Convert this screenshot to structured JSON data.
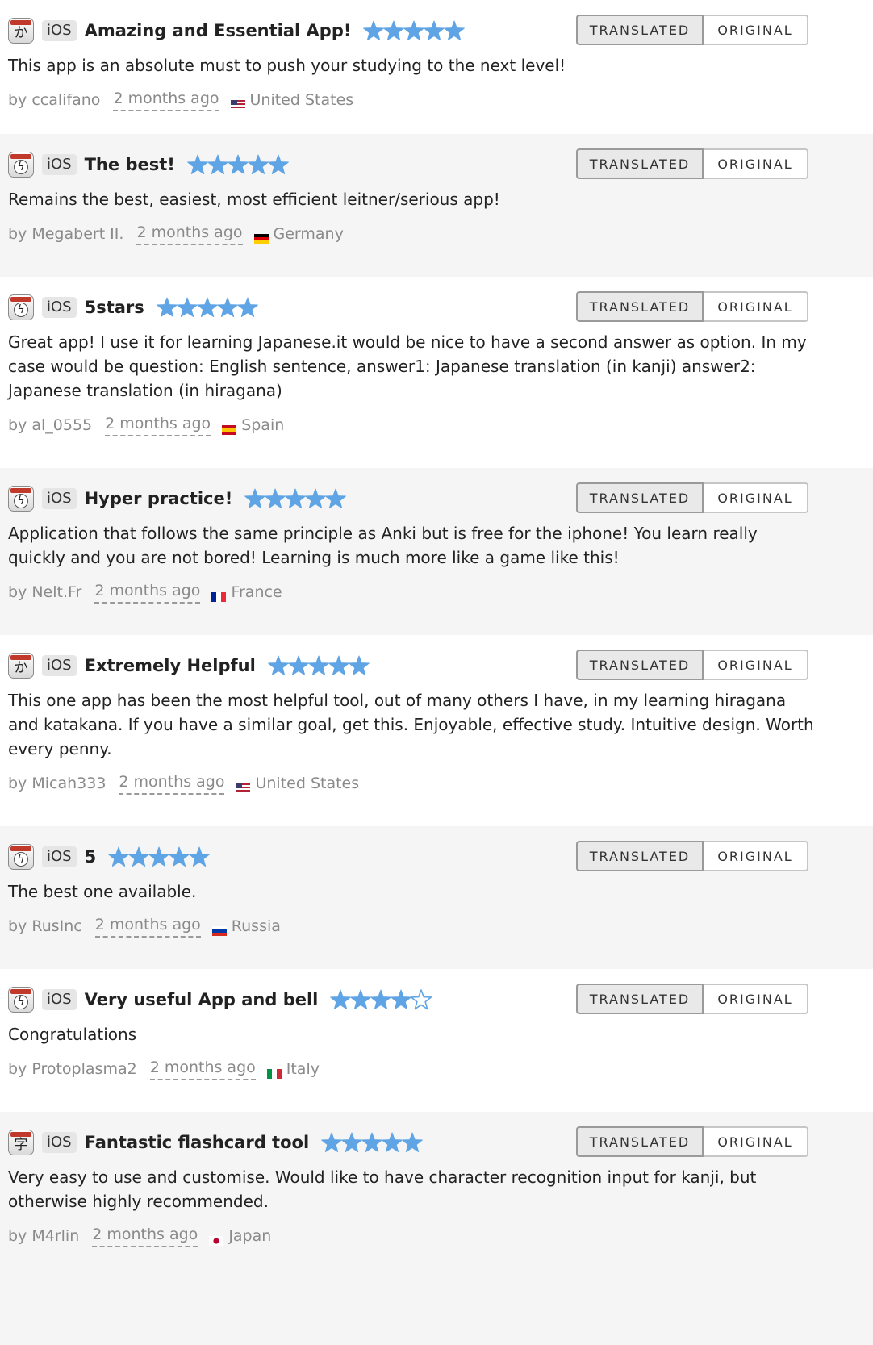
{
  "buttons": {
    "translated": "TRANSLATED",
    "original": "ORIGINAL"
  },
  "reviews": [
    {
      "icon": "kana-app-icon",
      "icon_glyph": "か",
      "platform": "iOS",
      "title": "Amazing and Essential App!",
      "rating": 5,
      "max_rating": 5,
      "body": "This app is an absolute must to push your studying to the next level!",
      "author": "by ccalifano",
      "time": "2 months ago",
      "country": "United States",
      "flag": "us-flag-icon"
    },
    {
      "icon": "flashcard-app-icon",
      "icon_glyph": "ϟ",
      "platform": "iOS",
      "title": "The best!",
      "rating": 5,
      "max_rating": 5,
      "body": "Remains the best, easiest, most efficient leitner/serious app!",
      "author": "by Megabert II.",
      "time": "2 months ago",
      "country": "Germany",
      "flag": "de-flag-icon"
    },
    {
      "icon": "flashcard-app-icon",
      "icon_glyph": "ϟ",
      "platform": "iOS",
      "title": "5stars",
      "rating": 5,
      "max_rating": 5,
      "body": "Great app! I use it for learning Japanese.it would be nice to have a second answer as option. In my case would be question: English sentence, answer1: Japanese translation (in kanji) answer2: Japanese translation (in hiragana)",
      "author": "by al_0555",
      "time": "2 months ago",
      "country": "Spain",
      "flag": "es-flag-icon"
    },
    {
      "icon": "flashcard-lite-app-icon",
      "icon_glyph": "ϟ",
      "platform": "iOS",
      "title": "Hyper practice!",
      "rating": 5,
      "max_rating": 5,
      "body": "Application that follows the same principle as Anki but is free for the iphone! You learn really quickly and you are not bored! Learning is much more like a game like this!",
      "author": "by Nelt.Fr",
      "time": "2 months ago",
      "country": "France",
      "flag": "fr-flag-icon"
    },
    {
      "icon": "kana-app-icon",
      "icon_glyph": "か",
      "platform": "iOS",
      "title": "Extremely Helpful",
      "rating": 5,
      "max_rating": 5,
      "body": "This one app has been the most helpful tool, out of many others I have, in my learning hiragana and katakana. If you have a similar goal, get this. Enjoyable, effective study. Intuitive design. Worth every penny.",
      "author": "by Micah333",
      "time": "2 months ago",
      "country": "United States",
      "flag": "us-flag-icon"
    },
    {
      "icon": "flashcard-app-icon",
      "icon_glyph": "ϟ",
      "platform": "iOS",
      "title": "5",
      "rating": 5,
      "max_rating": 5,
      "body": "The best one available.",
      "author": "by RusInc",
      "time": "2 months ago",
      "country": "Russia",
      "flag": "ru-flag-icon"
    },
    {
      "icon": "flashcard-lite-app-icon",
      "icon_glyph": "ϟ",
      "platform": "iOS",
      "title": "Very useful App and bell",
      "rating": 4,
      "max_rating": 5,
      "body": "Congratulations",
      "author": "by Protoplasma2",
      "time": "2 months ago",
      "country": "Italy",
      "flag": "it-flag-icon"
    },
    {
      "icon": "kanji-app-icon",
      "icon_glyph": "字",
      "platform": "iOS",
      "title": "Fantastic flashcard tool",
      "rating": 5,
      "max_rating": 5,
      "body": "Very easy to use and customise. Would like to have character recognition input for kanji, but otherwise highly recommended.",
      "author": "by M4rlin",
      "time": "2 months ago",
      "country": "Japan",
      "flag": "jp-flag-icon"
    }
  ],
  "colors": {
    "star": "#5fa4e4",
    "alt_row": "#f5f5f5",
    "meta_text": "#8a8a8a",
    "active_button": "#e9e9e9"
  }
}
